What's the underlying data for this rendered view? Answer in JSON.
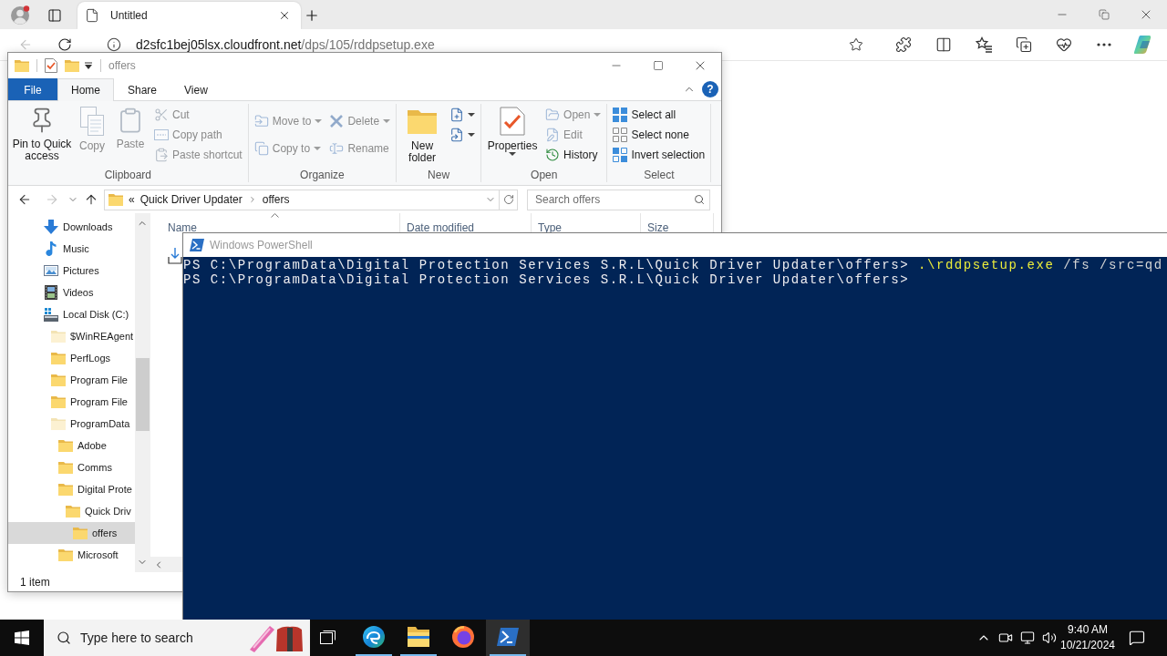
{
  "browser": {
    "tabs": [
      {
        "title": "Untitled",
        "selected": true
      }
    ],
    "back": {
      "disabled": true
    },
    "address": {
      "host": "d2sfc1bej05lsx.cloudfront.net",
      "path": "/dps/105/rddpsetup.exe"
    }
  },
  "explorer": {
    "title": "offers",
    "ribbon_tabs": [
      {
        "label": "File",
        "kind": "menu",
        "selected": false
      },
      {
        "label": "Home",
        "kind": "tab",
        "selected": true
      },
      {
        "label": "Share",
        "kind": "tab",
        "selected": false
      },
      {
        "label": "View",
        "kind": "tab",
        "selected": false
      }
    ],
    "help": "?",
    "groups": [
      {
        "label": "Clipboard",
        "columns": [
          {
            "kind": "large",
            "items": [
              {
                "label": "Pin to Quick access",
                "disabled": false,
                "menu": false
              }
            ]
          },
          {
            "kind": "large",
            "items": [
              {
                "label": "Copy",
                "disabled": true,
                "menu": false
              }
            ]
          },
          {
            "kind": "large",
            "items": [
              {
                "label": "Paste",
                "disabled": true,
                "menu": false
              }
            ]
          },
          {
            "kind": "stack",
            "items": [
              {
                "label": "Cut",
                "disabled": true,
                "menu": false
              },
              {
                "label": "Copy path",
                "disabled": true,
                "menu": false
              },
              {
                "label": "Paste shortcut",
                "disabled": true,
                "menu": false
              }
            ]
          }
        ]
      },
      {
        "label": "Organize",
        "columns": [
          {
            "kind": "stack",
            "items": [
              {
                "label": "Move to",
                "disabled": true,
                "menu": true
              },
              {
                "label": "Copy to",
                "disabled": true,
                "menu": true
              }
            ]
          },
          {
            "kind": "stack",
            "items": [
              {
                "label": "Delete",
                "disabled": true,
                "menu": true
              },
              {
                "label": "Rename",
                "disabled": true,
                "menu": false
              }
            ]
          }
        ]
      },
      {
        "label": "New",
        "columns": [
          {
            "kind": "large",
            "items": [
              {
                "label": "New folder",
                "disabled": false,
                "menu": false
              }
            ]
          },
          {
            "kind": "stack",
            "items": [
              {
                "disabled": false,
                "menu": true
              },
              {
                "disabled": false,
                "menu": true
              }
            ]
          }
        ]
      },
      {
        "label": "Open",
        "columns": [
          {
            "kind": "large",
            "items": [
              {
                "label": "Properties",
                "disabled": false,
                "menu": true
              }
            ]
          },
          {
            "kind": "stack",
            "items": [
              {
                "label": "Open",
                "disabled": true,
                "menu": true
              },
              {
                "label": "Edit",
                "disabled": true,
                "menu": false
              },
              {
                "label": "History",
                "disabled": false,
                "menu": false
              }
            ]
          }
        ]
      },
      {
        "label": "Select",
        "columns": [
          {
            "kind": "stack",
            "items": [
              {
                "label": "Select all",
                "disabled": false,
                "menu": false
              },
              {
                "label": "Select none",
                "disabled": false,
                "menu": false
              },
              {
                "label": "Invert selection",
                "disabled": false,
                "menu": false
              }
            ]
          }
        ]
      }
    ],
    "forward": {
      "disabled": true
    },
    "breadcrumb": {
      "overflow": "«",
      "parts": [
        "Quick Driver Updater",
        "offers"
      ]
    },
    "search": {
      "placeholder": "Search offers"
    },
    "tree": [
      {
        "label": "Downloads",
        "kind": "downloads",
        "selected": false
      },
      {
        "label": "Music",
        "kind": "music",
        "selected": false
      },
      {
        "label": "Pictures",
        "kind": "pictures",
        "selected": false
      },
      {
        "label": "Videos",
        "kind": "videos",
        "selected": false
      },
      {
        "label": "Local Disk (C:)",
        "kind": "drive",
        "selected": false,
        "children": [
          {
            "label": "$WinREAgent",
            "kind": "hidden",
            "selected": false
          },
          {
            "label": "PerfLogs",
            "kind": "folder",
            "selected": false
          },
          {
            "label": "Program File",
            "kind": "folder",
            "selected": false
          },
          {
            "label": "Program File",
            "kind": "folder",
            "selected": false
          },
          {
            "label": "ProgramData",
            "kind": "hidden",
            "selected": false,
            "children": [
              {
                "label": "Adobe",
                "kind": "folder",
                "selected": false
              },
              {
                "label": "Comms",
                "kind": "folder",
                "selected": false
              },
              {
                "label": "Digital Prote",
                "kind": "folder",
                "selected": false,
                "children": [
                  {
                    "label": "Quick Driv",
                    "kind": "folder",
                    "selected": false,
                    "children": [
                      {
                        "label": "offers",
                        "kind": "folder",
                        "selected": true
                      }
                    ]
                  }
                ]
              },
              {
                "label": "Microsoft",
                "kind": "folder",
                "selected": false
              }
            ]
          }
        ]
      }
    ],
    "columns": [
      {
        "label": "Name",
        "sorted": true
      },
      {
        "label": "Date modified",
        "sorted": false
      },
      {
        "label": "Type",
        "sorted": false
      },
      {
        "label": "Size",
        "sorted": false
      }
    ],
    "status": "1 item"
  },
  "powershell": {
    "title": "Windows PowerShell",
    "lines": [
      {
        "segments": [
          {
            "kind": "prompt",
            "text": "PS C:\\ProgramData\\Digital Protection Services S.R.L\\Quick Driver Updater\\offers>"
          },
          {
            "kind": "command",
            "text": ".\\rddpsetup.exe"
          },
          {
            "kind": "argument",
            "text": "/fs /src=qd"
          }
        ]
      },
      {
        "segments": [
          {
            "kind": "prompt",
            "text": "PS C:\\ProgramData\\Digital Protection Services S.R.L\\Quick Driver Updater\\offers>"
          }
        ]
      }
    ]
  },
  "taskbar": {
    "search": {
      "placeholder": "Type here to search"
    },
    "apps": [
      {
        "kind": "taskview",
        "running": false,
        "selected": false
      },
      {
        "kind": "browser",
        "running": true,
        "selected": false
      },
      {
        "kind": "files",
        "running": true,
        "selected": false
      },
      {
        "kind": "fox",
        "running": false,
        "selected": false
      },
      {
        "kind": "shell",
        "running": true,
        "selected": true
      }
    ],
    "clock": {
      "time": "9:40 AM",
      "date": "10/21/2024"
    }
  }
}
